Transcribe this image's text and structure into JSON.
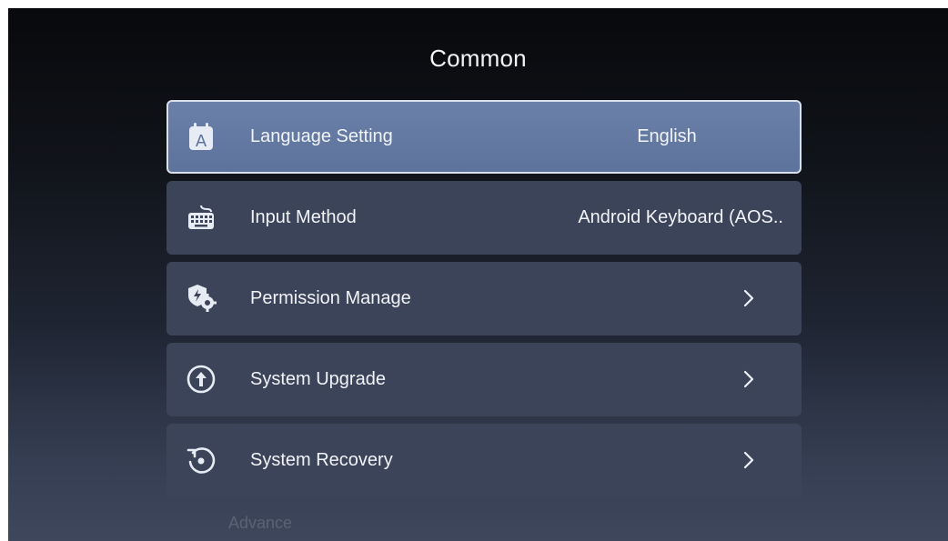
{
  "page": {
    "title": "Common"
  },
  "menu": {
    "items": [
      {
        "label": "Language Setting",
        "value": "English",
        "icon": "language-icon",
        "selected": true
      },
      {
        "label": "Input Method",
        "value": "Android Keyboard (AOS..",
        "icon": "keyboard-icon"
      },
      {
        "label": "Permission Manage",
        "icon": "permission-icon"
      },
      {
        "label": "System Upgrade",
        "icon": "upgrade-icon"
      },
      {
        "label": "System Recovery",
        "icon": "recovery-icon"
      }
    ]
  },
  "footer": {
    "partial_text": "Advance"
  },
  "colors": {
    "selected_bg": "#6479a2",
    "item_bg": "#3c4459",
    "text": "#f1f3f7"
  }
}
